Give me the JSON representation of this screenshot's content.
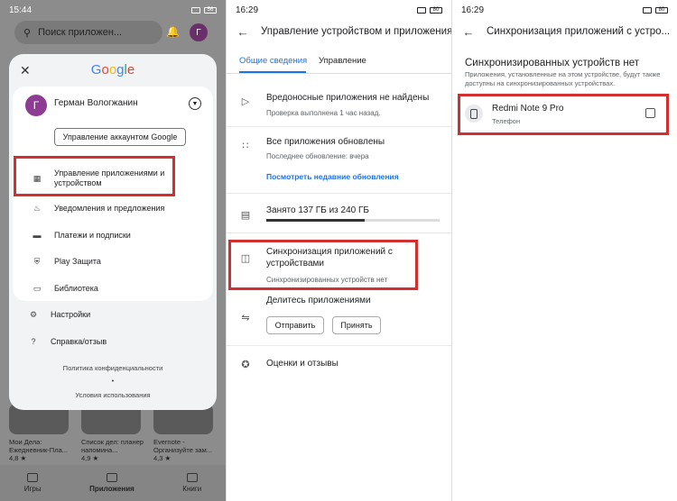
{
  "panel1": {
    "status_time": "15:44",
    "status_battery": "56",
    "search_placeholder": "Поиск приложен...",
    "avatar_letter": "Г",
    "dialog": {
      "brand": "Google",
      "account_name": "Герман Вологжанин",
      "avatar_letter": "Г",
      "manage_account": "Управление аккаунтом Google",
      "menu": [
        "Управление приложениями и устройством",
        "Уведомления и предложения",
        "Платежи и подписки",
        "Play Защита",
        "Библиотека",
        "Настройки",
        "Справка/отзыв"
      ],
      "privacy": "Политика конфиденциальности",
      "dot": "•",
      "terms": "Условия использования"
    },
    "bg_apps": [
      {
        "name": "Мои Дела: Ежедневник-Пла...",
        "rating": "4,8 ★"
      },
      {
        "name": "Список дел: планер напомина...",
        "rating": "4,9 ★"
      },
      {
        "name": "Evernote - Организуйте зам...",
        "rating": "4,3 ★"
      }
    ],
    "bg_nav": [
      "Игры",
      "Приложения",
      "Книги"
    ]
  },
  "panel2": {
    "status_time": "16:29",
    "status_battery": "80",
    "title": "Управление устройством и приложения",
    "tabs": [
      "Общие сведения",
      "Управление"
    ],
    "malware_title": "Вредоносные приложения не найдены",
    "malware_sub": "Проверка выполнена 1 час назад.",
    "updates_title": "Все приложения обновлены",
    "updates_sub": "Последнее обновление: вчера",
    "updates_link": "Посмотреть недавние обновления",
    "storage": "Занято 137 ГБ из 240 ГБ",
    "storage_fraction": 0.57,
    "sync_title": "Синхронизация приложений с устройствами",
    "sync_sub": "Синхронизированных устройств нет",
    "share_title": "Делитесь приложениями",
    "share_send": "Отправить",
    "share_receive": "Принять",
    "ratings": "Оценки и отзывы"
  },
  "panel3": {
    "status_time": "16:29",
    "status_battery": "80",
    "title": "Синхронизация приложений с устро...",
    "heading": "Синхронизированных устройств нет",
    "description": "Приложения, установленные на этом устройстве, будут также доступны на синхронизированных устройствах.",
    "device_name": "Redmi Note 9 Pro",
    "device_type": "Телефон"
  },
  "colors": {
    "highlight": "#d32f2f",
    "accent": "#1a73e8"
  }
}
